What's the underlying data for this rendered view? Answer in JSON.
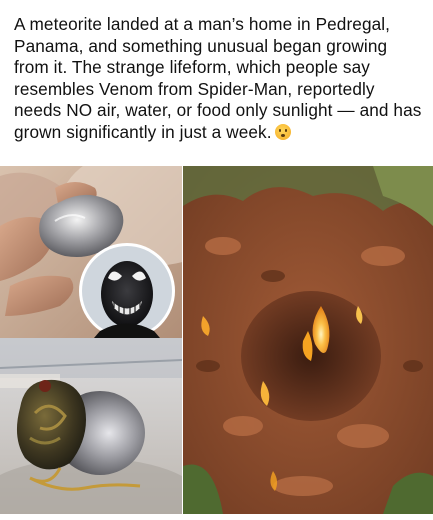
{
  "post": {
    "caption": "A meteorite landed at a man’s home in Pedregal, Panama, and something unusual began growing from it. The strange lifeform, which people say resembles Venom from Spider-Man, reportedly needs NO air, water, or food only sunlight — and has grown significantly in just a week.",
    "emoji_icon": "flushed-face-emoji"
  },
  "images": [
    {
      "name": "hand-holding-silver-rock",
      "icon": "photo"
    },
    {
      "name": "venom-inset",
      "icon": "photo"
    },
    {
      "name": "rock-with-growth",
      "icon": "photo"
    },
    {
      "name": "burning-hole-in-soil",
      "icon": "photo"
    }
  ],
  "colors": {
    "background": "#ffffff",
    "text": "#111111",
    "soil": "#8a4a2c",
    "flame": "#f6a321"
  }
}
